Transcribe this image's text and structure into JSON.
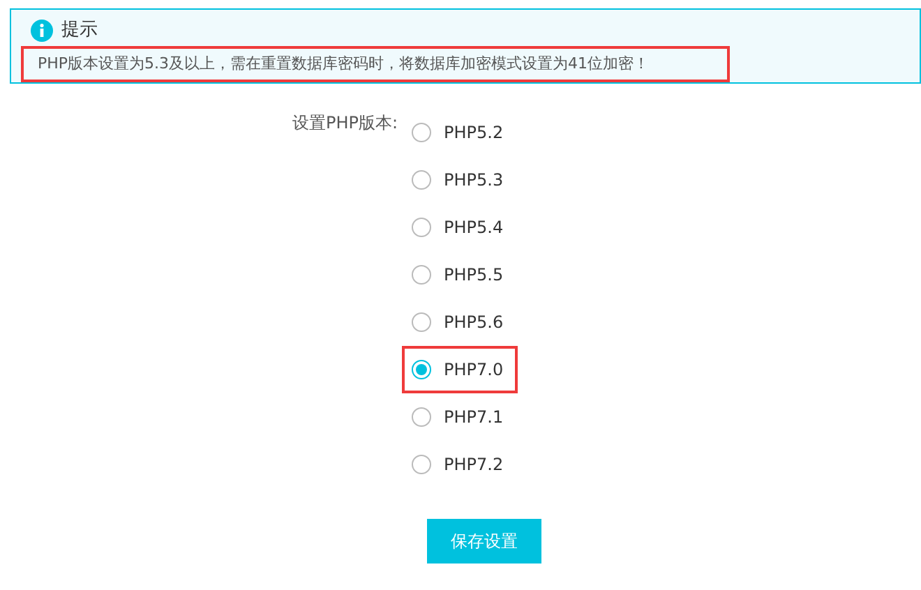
{
  "notice": {
    "title": "提示",
    "message": "PHP版本设置为5.3及以上，需在重置数据库密码时，将数据库加密模式设置为41位加密！",
    "highlighted": true
  },
  "php_version": {
    "label": "设置PHP版本:",
    "options": [
      {
        "label": "PHP5.2",
        "selected": false,
        "highlighted": false
      },
      {
        "label": "PHP5.3",
        "selected": false,
        "highlighted": false
      },
      {
        "label": "PHP5.4",
        "selected": false,
        "highlighted": false
      },
      {
        "label": "PHP5.5",
        "selected": false,
        "highlighted": false
      },
      {
        "label": "PHP5.6",
        "selected": false,
        "highlighted": false
      },
      {
        "label": "PHP7.0",
        "selected": true,
        "highlighted": true
      },
      {
        "label": "PHP7.1",
        "selected": false,
        "highlighted": false
      },
      {
        "label": "PHP7.2",
        "selected": false,
        "highlighted": false
      }
    ]
  },
  "save_button": "保存设置"
}
